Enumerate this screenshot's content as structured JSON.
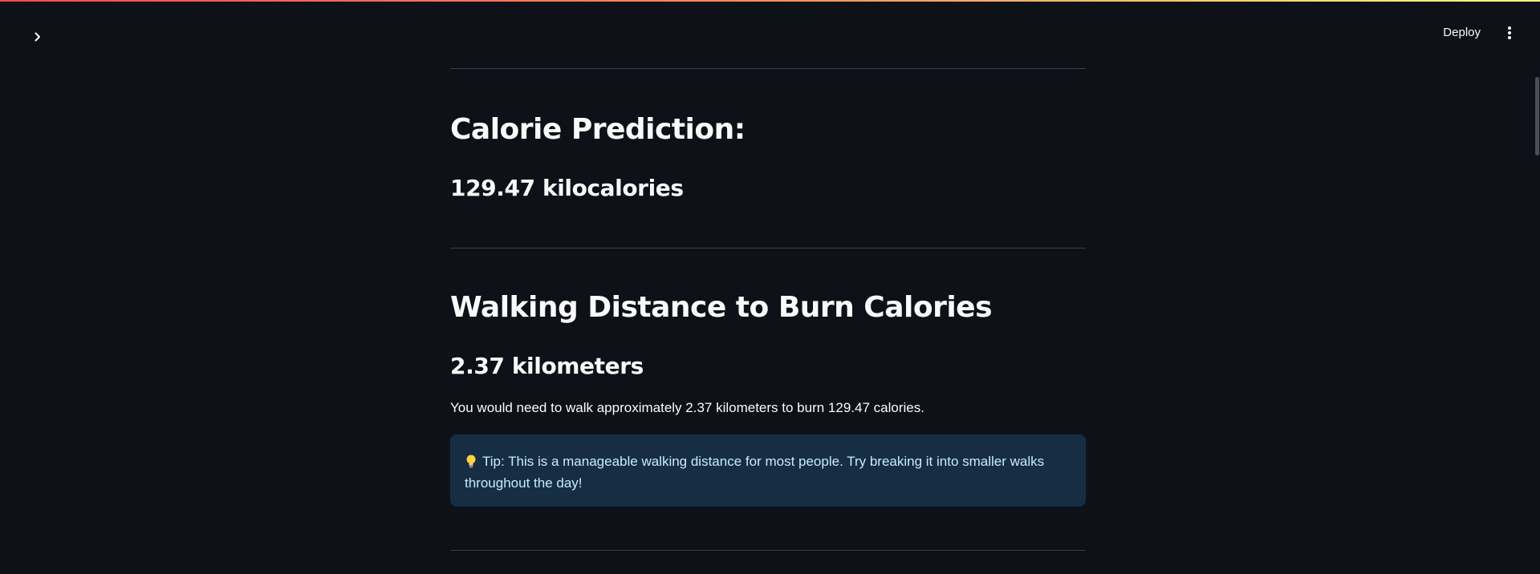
{
  "toolbar": {
    "deploy_label": "Deploy"
  },
  "icons": {
    "sidebar_toggle": "chevron-right-icon",
    "menu": "more-vertical-icon",
    "tip": "light-bulb-icon"
  },
  "sections": {
    "calorie": {
      "heading": "Calorie Prediction:",
      "value": "129.47 kilocalories"
    },
    "walking": {
      "heading": "Walking Distance to Burn Calories",
      "value": "2.37 kilometers",
      "description": "You would need to walk approximately 2.37 kilometers to burn 129.47 calories.",
      "tip_line1": "Tip: This is a manageable walking distance for most people. Try breaking it into smaller walks",
      "tip_line2": "throughout the day!"
    }
  },
  "colors": {
    "background": "#0e1117",
    "text": "#fafafa",
    "info_background": "#172d43",
    "info_text": "#c7ebff",
    "divider": "#3a3d45"
  }
}
